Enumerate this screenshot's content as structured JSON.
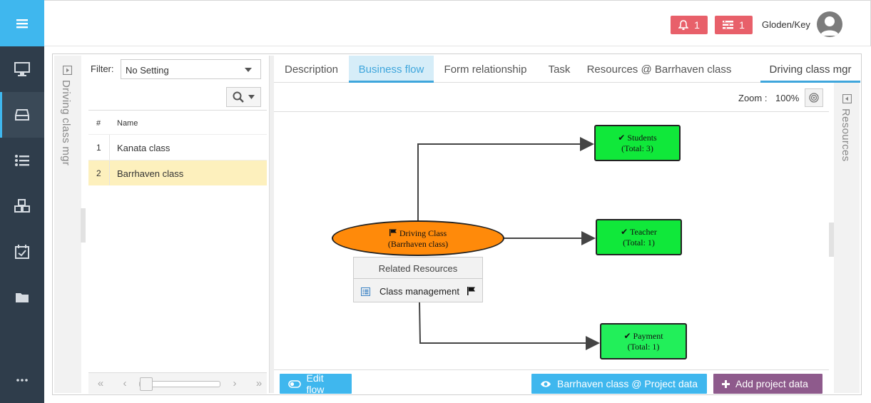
{
  "topbar": {
    "notifications_count": "1",
    "messages_count": "1",
    "user_name": "Gloden/Key"
  },
  "side_left": {
    "label": "Driving class mgr"
  },
  "side_right": {
    "label": "Resources"
  },
  "filter": {
    "label": "Filter:",
    "value": "No Setting"
  },
  "list": {
    "columns": [
      "#",
      "Name"
    ],
    "rows": [
      {
        "num": "1",
        "name": "Kanata class"
      },
      {
        "num": "2",
        "name": "Barrhaven class"
      }
    ]
  },
  "tabs": [
    {
      "label": "Description"
    },
    {
      "label": "Business flow"
    },
    {
      "label": "Form relationship"
    },
    {
      "label": "Task"
    },
    {
      "label": "Resources @ Barrhaven class"
    },
    {
      "label": "Driving class mgr"
    }
  ],
  "zoom": {
    "label": "Zoom :",
    "value": "100%"
  },
  "flow": {
    "center": {
      "line1": "Driving Class",
      "line2": "(Barrhaven class)"
    },
    "nodes": [
      {
        "title": "Students",
        "total": "(Total: 3)"
      },
      {
        "title": "Teacher",
        "total": "(Total: 1)"
      },
      {
        "title": "Payment",
        "total": "(Total: 1)"
      }
    ],
    "related": {
      "title": "Related Resources",
      "item": "Class management"
    }
  },
  "actions": {
    "edit_flow": "Edit flow",
    "project_data": "Barrhaven class @ Project data",
    "add_project_data": "Add project data"
  },
  "colors": {
    "accent": "#3fb7ee",
    "rail": "#2f3d4b",
    "badge": "#e8606a",
    "node_green": "#10e83a",
    "center_orange": "#ff8a0a",
    "add_button": "#8e5a8c",
    "selected_row": "#fdf0bd"
  }
}
